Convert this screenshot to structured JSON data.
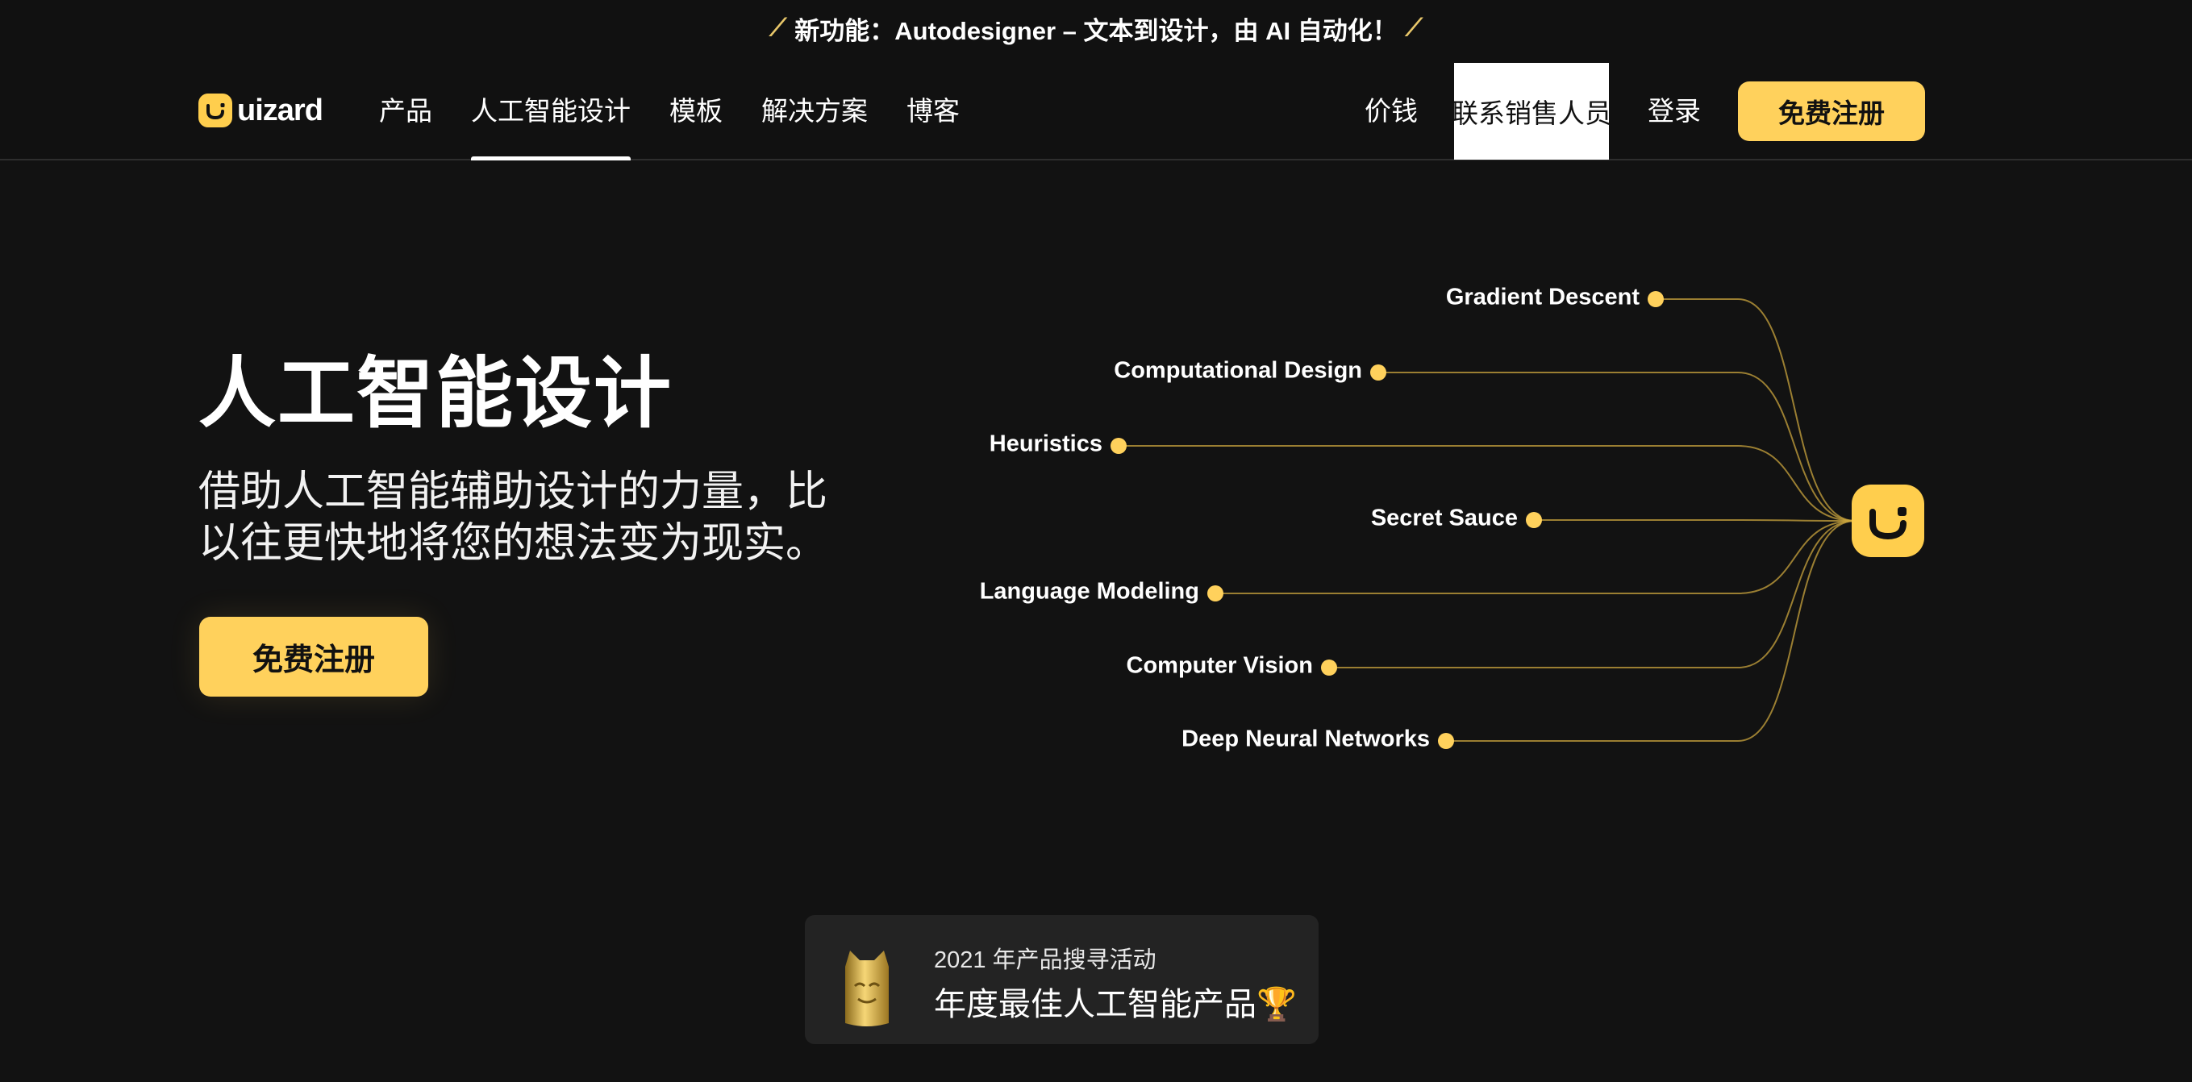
{
  "announcement": {
    "icon_left": "magic-wand-icon",
    "text": "新功能：Autodesigner – 文本到设计，由 AI 自动化！",
    "icon_right": "magic-wand-icon"
  },
  "brand": {
    "logo_text": "uizard",
    "accent_color": "#ffd15c"
  },
  "nav": {
    "items": [
      {
        "label": "产品"
      },
      {
        "label": "人工智能设计"
      },
      {
        "label": "模板"
      },
      {
        "label": "解决方案"
      },
      {
        "label": "博客"
      }
    ],
    "active_index": 1,
    "pricing": "价钱",
    "contact_sales": "联系销售人员",
    "login": "登录",
    "signup": "免费注册"
  },
  "hero": {
    "title": "人工智能设计",
    "subtitle": "借助人工智能辅助设计的力量，比以往更快地将您的想法变为现实。",
    "cta": "免费注册"
  },
  "diagram": {
    "topics": [
      "Gradient Descent",
      "Computational Design",
      "Heuristics",
      "Secret Sauce",
      "Language Modeling",
      "Computer Vision",
      "Deep Neural Networks"
    ],
    "hub_icon": "uizard-logo-icon",
    "line_color": "#c9a43d",
    "dot_color": "#ffd15c"
  },
  "award": {
    "badge_icon": "golden-kitty-icon",
    "small_text": "2021 年产品搜寻活动",
    "big_text": "年度最佳人工智能产品🏆"
  }
}
